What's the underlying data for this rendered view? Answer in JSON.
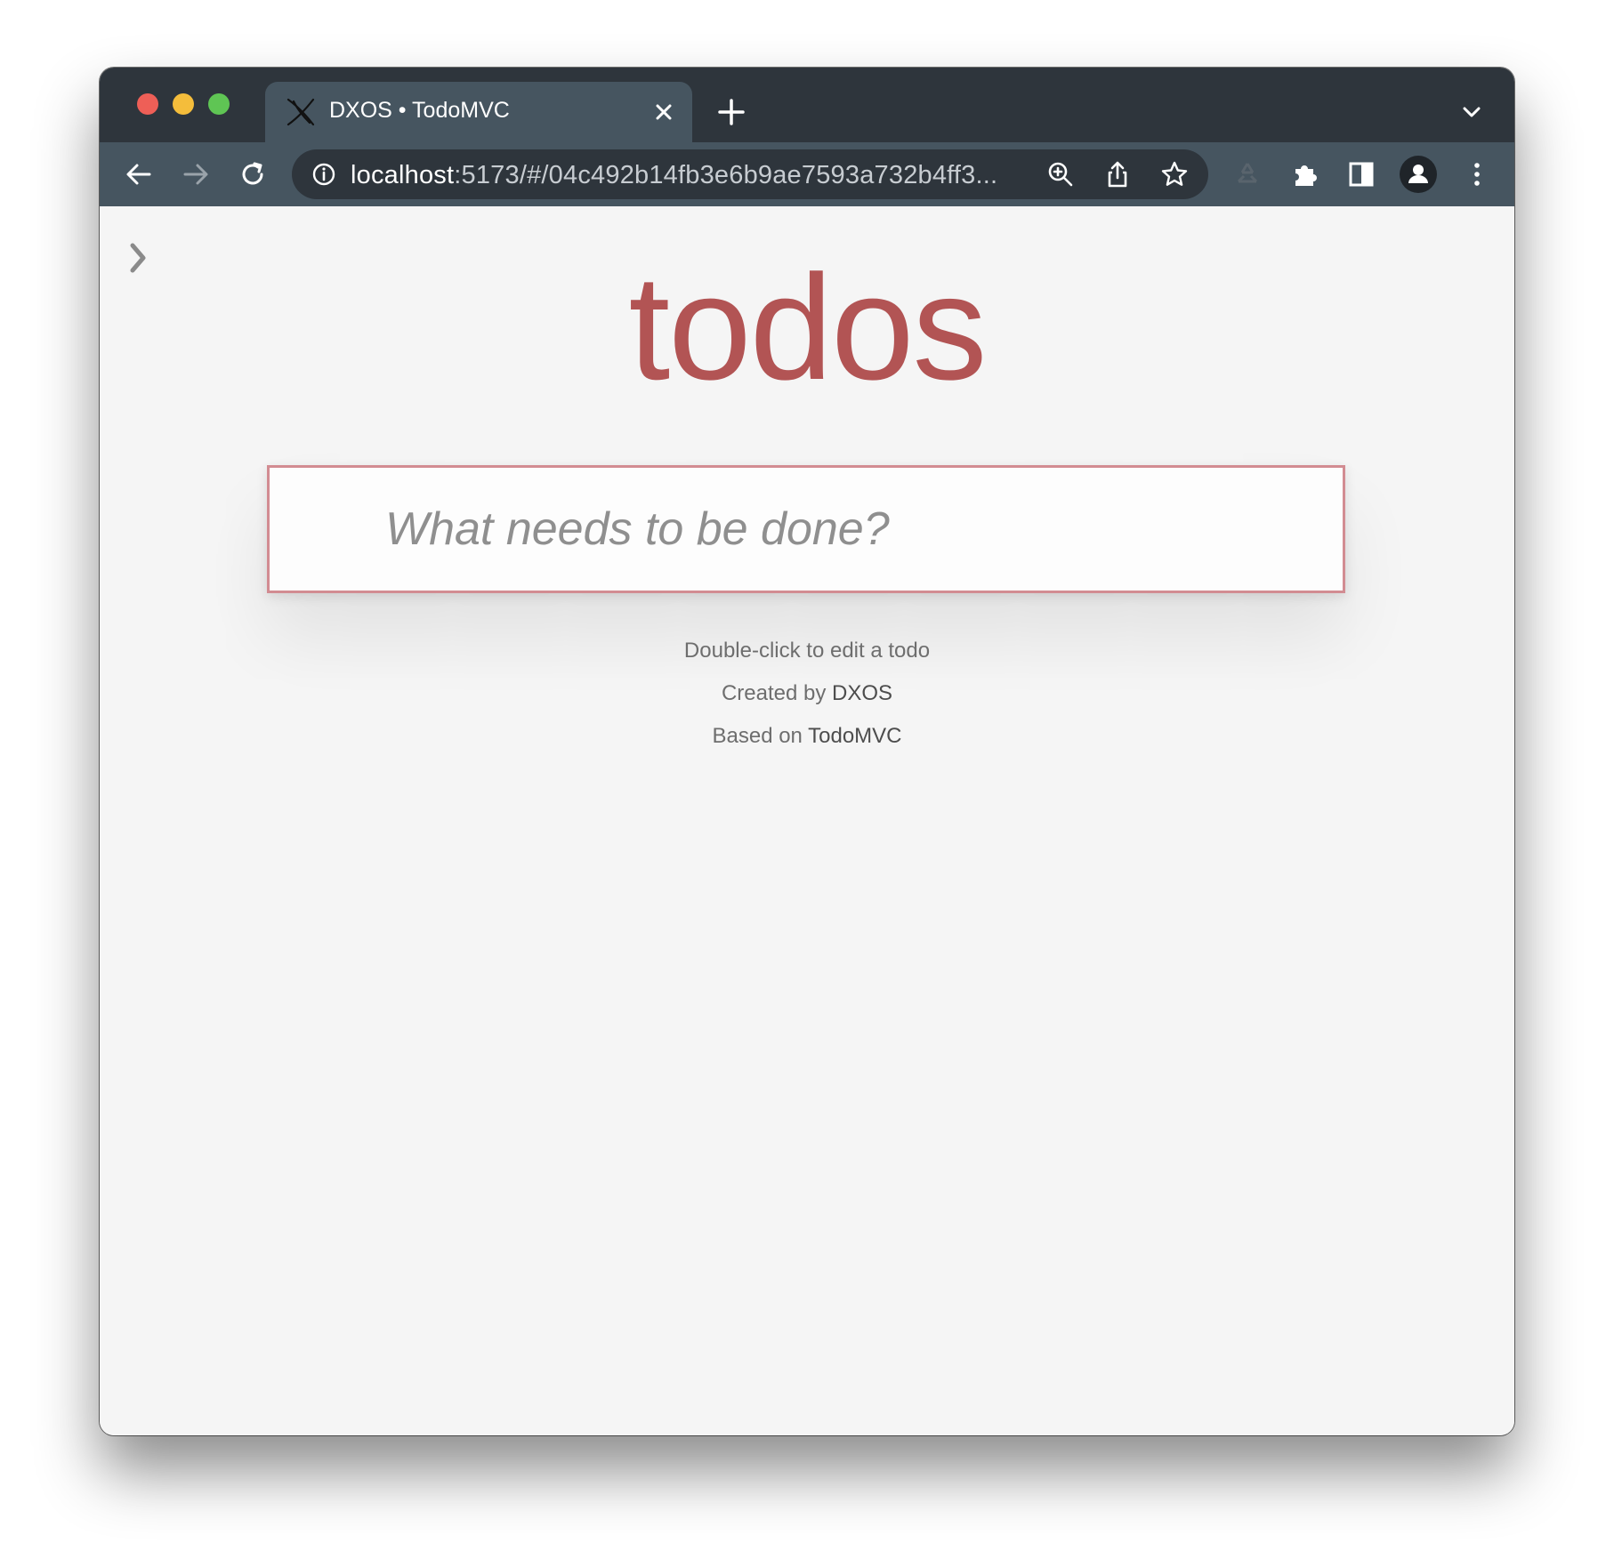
{
  "browser": {
    "tab": {
      "title": "DXOS • TodoMVC",
      "favicon": "dxos-logo-icon"
    },
    "url": {
      "host": "localhost",
      "path": ":5173/#/04c492b14fb3e6b9ae7593a732b4ff3..."
    },
    "colors": {
      "tabstrip": "#2e353c",
      "toolbar": "#465560",
      "traffic_red": "#ee5f57",
      "traffic_yellow": "#f4bd3b",
      "traffic_green": "#5fc554"
    }
  },
  "app": {
    "title": "todos",
    "new_todo_placeholder": "What needs to be done?",
    "colors": {
      "title": "#b25454",
      "input_border": "#d28c92",
      "background": "#f5f5f5"
    },
    "footer": {
      "hint": "Double-click to edit a todo",
      "created_prefix": "Created by",
      "created_link": "DXOS",
      "based_prefix": "Based on",
      "based_link": "TodoMVC"
    }
  }
}
